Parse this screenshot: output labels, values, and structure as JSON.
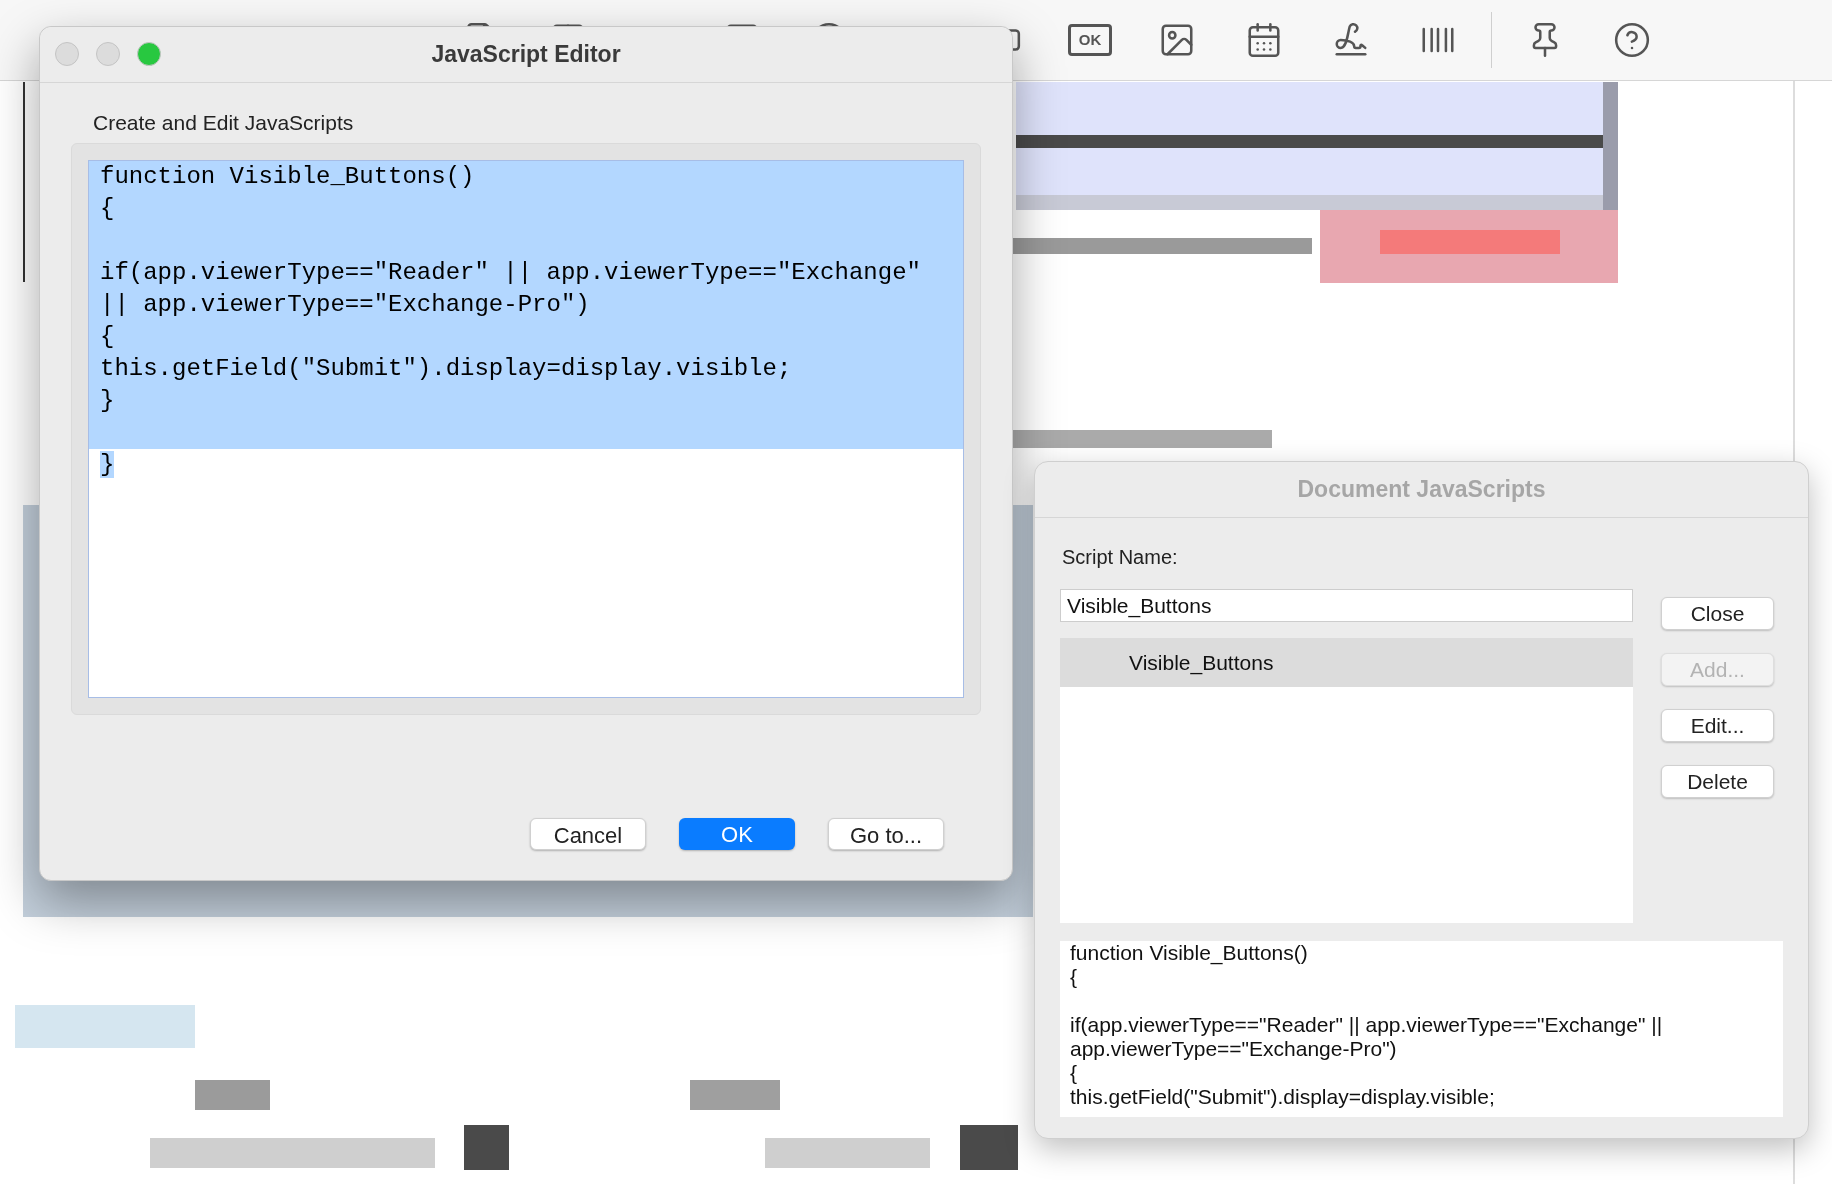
{
  "toolbar": {
    "button_tool_label": "OK"
  },
  "editor": {
    "title": "JavaScript Editor",
    "active": true,
    "window_controls": [
      {
        "kind": "close",
        "enabled": false
      },
      {
        "kind": "minimize",
        "enabled": false
      },
      {
        "kind": "zoom",
        "enabled": true
      }
    ],
    "heading": "Create and Edit JavaScripts",
    "lines": [
      {
        "text": "function Visible_Buttons()",
        "selected": true
      },
      {
        "text": "{",
        "selected": true
      },
      {
        "selected": true
      },
      {
        "text": "if(app.viewerType==\"Reader\" || app.viewerType==\"Exchange\"",
        "selected": true
      },
      {
        "text": "|| app.viewerType==\"Exchange-Pro\")",
        "selected": true
      },
      {
        "text": "{",
        "selected": true
      },
      {
        "text": "this.getField(\"Submit\").display=display.visible;",
        "selected": true
      },
      {
        "text": "}",
        "selected": true
      },
      {
        "selected": true
      },
      {
        "text": "}",
        "selected": true
      }
    ],
    "buttons": [
      {
        "label": "Cancel",
        "default": false
      },
      {
        "label": "OK",
        "default": true
      },
      {
        "label": "Go to...",
        "default": false
      }
    ]
  },
  "document_scripts": {
    "title": "Document JavaScripts",
    "active": false,
    "script_name_label": "Script Name:",
    "script_name_value": "Visible_Buttons",
    "scripts": [
      {
        "name": "Visible_Buttons",
        "selected": true
      }
    ],
    "buttons": [
      {
        "label": "Close",
        "disabled": false
      },
      {
        "label": "Add...",
        "disabled": true
      },
      {
        "label": "Edit...",
        "disabled": false
      },
      {
        "label": "Delete",
        "disabled": false
      }
    ],
    "preview": "function Visible_Buttons()\n{\n\nif(app.viewerType==\"Reader\" || app.viewerType==\"Exchange\" ||\napp.viewerType==\"Exchange-Pro\")\n{\nthis.getField(\"Submit\").display=display.visible;"
  }
}
